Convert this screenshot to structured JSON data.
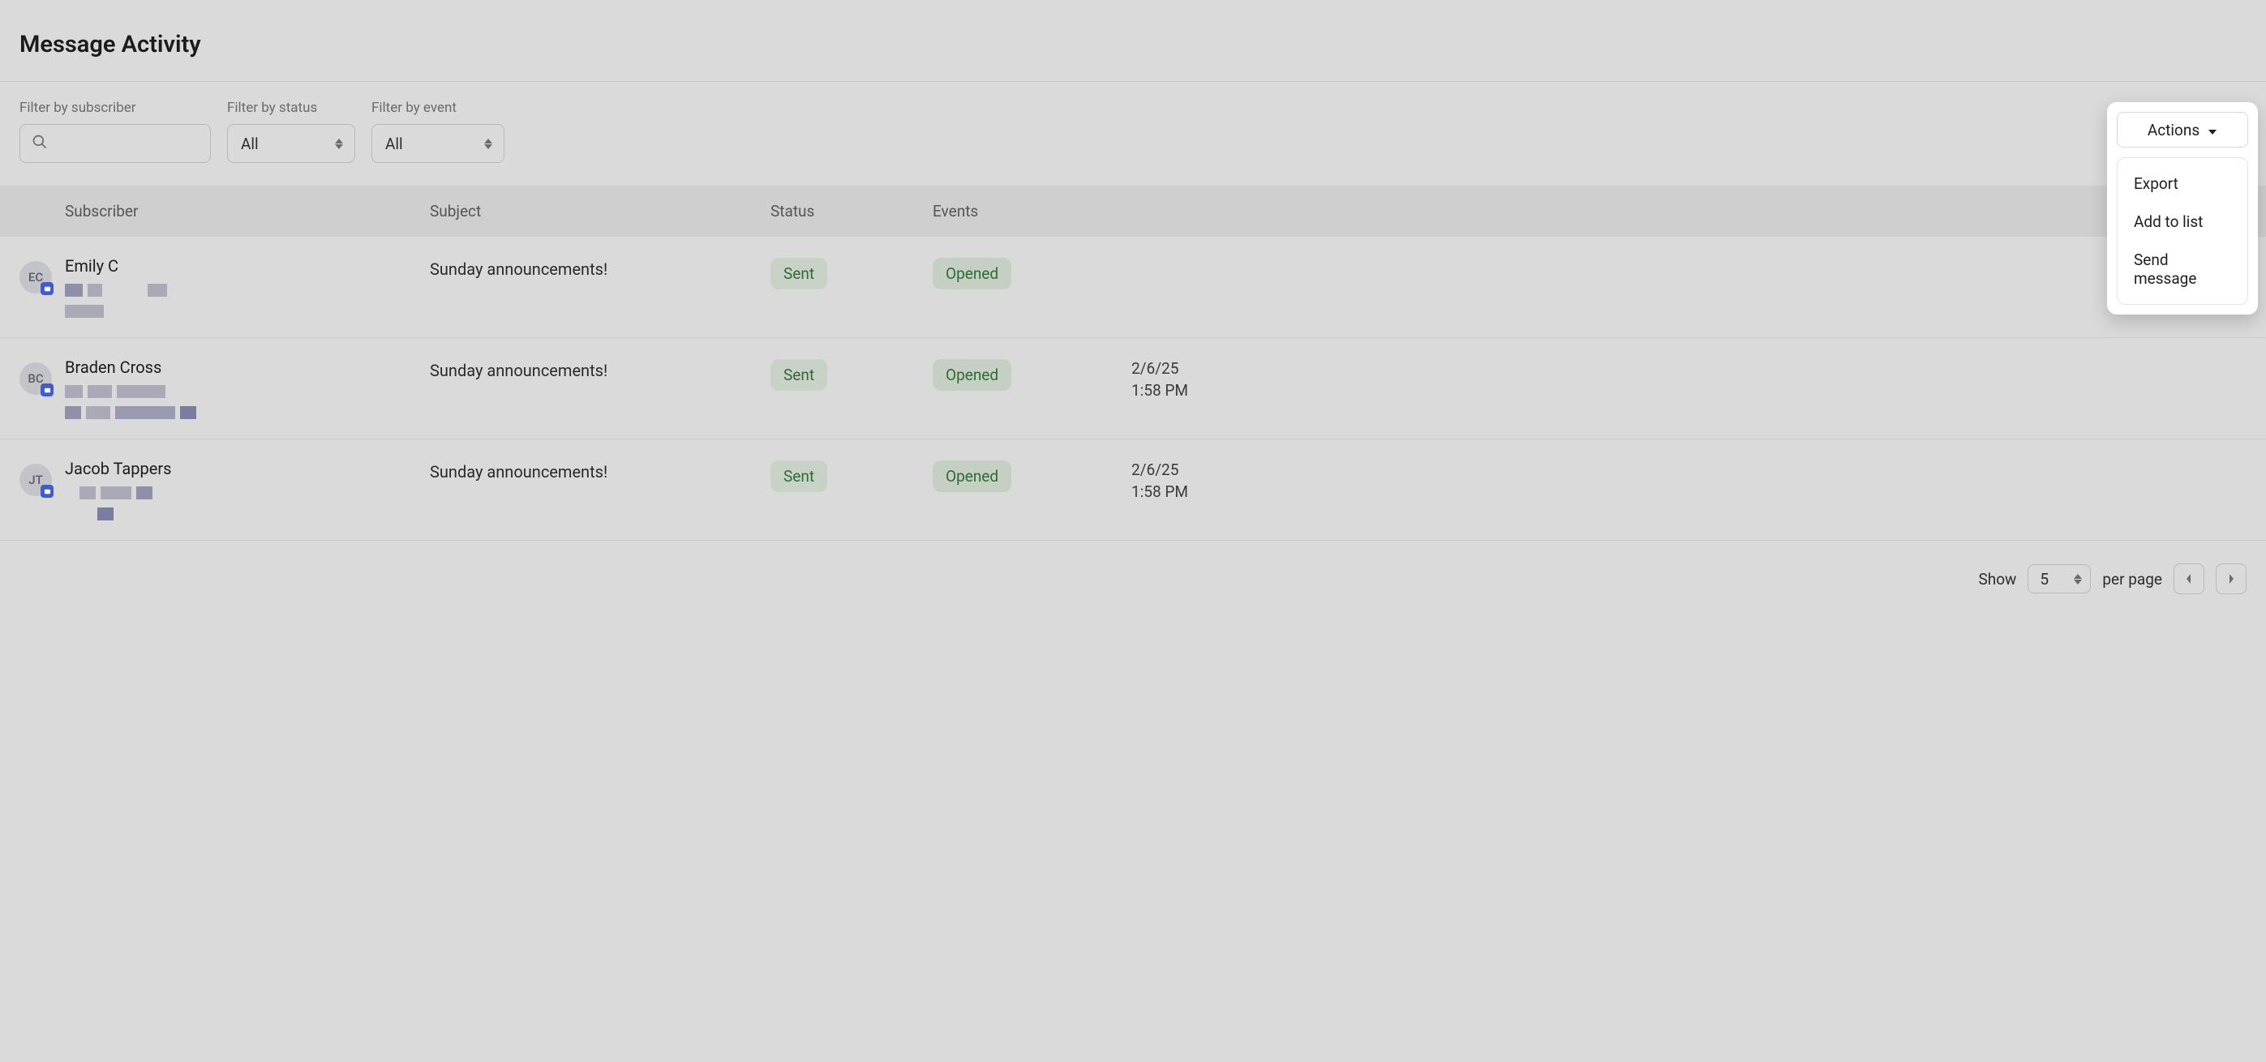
{
  "page": {
    "title": "Message Activity"
  },
  "filters": {
    "subscriber_label": "Filter by subscriber",
    "status_label": "Filter by status",
    "status_value": "All",
    "event_label": "Filter by event",
    "event_value": "All"
  },
  "actions": {
    "button_label": "Actions",
    "menu": {
      "export": "Export",
      "add_to_list": "Add to list",
      "send_message": "Send message"
    }
  },
  "columns": {
    "subscriber": "Subscriber",
    "subject": "Subject",
    "status": "Status",
    "events": "Events"
  },
  "rows": [
    {
      "initials": "EC",
      "name": "Emily C",
      "subject": "Sunday announcements!",
      "status": "Sent",
      "event": "Opened",
      "date": "",
      "time": ""
    },
    {
      "initials": "BC",
      "name": "Braden Cross",
      "subject": "Sunday announcements!",
      "status": "Sent",
      "event": "Opened",
      "date": "2/6/25",
      "time": "1:58 PM"
    },
    {
      "initials": "JT",
      "name": "Jacob Tappers",
      "subject": "Sunday announcements!",
      "status": "Sent",
      "event": "Opened",
      "date": "2/6/25",
      "time": "1:58 PM"
    }
  ],
  "pagination": {
    "show_label": "Show",
    "per_page_label": "per page",
    "page_size": "5"
  }
}
